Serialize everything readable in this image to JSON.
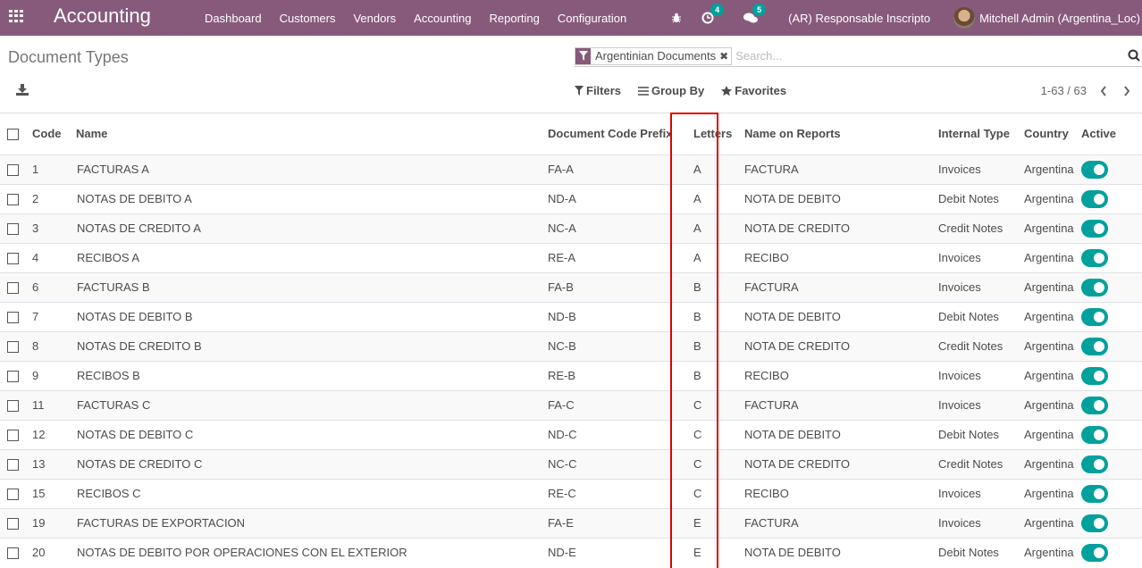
{
  "navbar": {
    "app_title": "Accounting",
    "menu": [
      "Dashboard",
      "Customers",
      "Vendors",
      "Accounting",
      "Reporting",
      "Configuration"
    ],
    "activity_count": "4",
    "message_count": "5",
    "company": "(AR) Responsable Inscripto",
    "user": "Mitchell Admin (Argentina_Loc)",
    "color": "#875a7b"
  },
  "control_panel": {
    "title": "Document Types",
    "facet_label": "Argentinian Documents",
    "search_placeholder": "Search...",
    "filters_label": "Filters",
    "group_by_label": "Group By",
    "favorites_label": "Favorites",
    "pager": "1-63 / 63"
  },
  "table": {
    "columns": [
      "Code",
      "Name",
      "Document Code Prefix",
      "Letters",
      "Name on Reports",
      "Internal Type",
      "Country",
      "Active"
    ],
    "highlighted_column": "Letters",
    "toggle_color": "#00a09d",
    "rows": [
      {
        "code": "1",
        "name": "FACTURAS A",
        "prefix": "FA-A",
        "letter": "A",
        "report_name": "FACTURA",
        "internal_type": "Invoices",
        "country": "Argentina",
        "active": true
      },
      {
        "code": "2",
        "name": "NOTAS DE DEBITO A",
        "prefix": "ND-A",
        "letter": "A",
        "report_name": "NOTA DE DEBITO",
        "internal_type": "Debit Notes",
        "country": "Argentina",
        "active": true
      },
      {
        "code": "3",
        "name": "NOTAS DE CREDITO A",
        "prefix": "NC-A",
        "letter": "A",
        "report_name": "NOTA DE CREDITO",
        "internal_type": "Credit Notes",
        "country": "Argentina",
        "active": true
      },
      {
        "code": "4",
        "name": "RECIBOS A",
        "prefix": "RE-A",
        "letter": "A",
        "report_name": "RECIBO",
        "internal_type": "Invoices",
        "country": "Argentina",
        "active": true
      },
      {
        "code": "6",
        "name": "FACTURAS B",
        "prefix": "FA-B",
        "letter": "B",
        "report_name": "FACTURA",
        "internal_type": "Invoices",
        "country": "Argentina",
        "active": true
      },
      {
        "code": "7",
        "name": "NOTAS DE DEBITO B",
        "prefix": "ND-B",
        "letter": "B",
        "report_name": "NOTA DE DEBITO",
        "internal_type": "Debit Notes",
        "country": "Argentina",
        "active": true
      },
      {
        "code": "8",
        "name": "NOTAS DE CREDITO B",
        "prefix": "NC-B",
        "letter": "B",
        "report_name": "NOTA DE CREDITO",
        "internal_type": "Credit Notes",
        "country": "Argentina",
        "active": true
      },
      {
        "code": "9",
        "name": "RECIBOS B",
        "prefix": "RE-B",
        "letter": "B",
        "report_name": "RECIBO",
        "internal_type": "Invoices",
        "country": "Argentina",
        "active": true
      },
      {
        "code": "11",
        "name": "FACTURAS C",
        "prefix": "FA-C",
        "letter": "C",
        "report_name": "FACTURA",
        "internal_type": "Invoices",
        "country": "Argentina",
        "active": true
      },
      {
        "code": "12",
        "name": "NOTAS DE DEBITO C",
        "prefix": "ND-C",
        "letter": "C",
        "report_name": "NOTA DE DEBITO",
        "internal_type": "Debit Notes",
        "country": "Argentina",
        "active": true
      },
      {
        "code": "13",
        "name": "NOTAS DE CREDITO C",
        "prefix": "NC-C",
        "letter": "C",
        "report_name": "NOTA DE CREDITO",
        "internal_type": "Credit Notes",
        "country": "Argentina",
        "active": true
      },
      {
        "code": "15",
        "name": "RECIBOS C",
        "prefix": "RE-C",
        "letter": "C",
        "report_name": "RECIBO",
        "internal_type": "Invoices",
        "country": "Argentina",
        "active": true
      },
      {
        "code": "19",
        "name": "FACTURAS DE EXPORTACION",
        "prefix": "FA-E",
        "letter": "E",
        "report_name": "FACTURA",
        "internal_type": "Invoices",
        "country": "Argentina",
        "active": true
      },
      {
        "code": "20",
        "name": "NOTAS DE DEBITO POR OPERACIONES CON EL EXTERIOR",
        "prefix": "ND-E",
        "letter": "E",
        "report_name": "NOTA DE DEBITO",
        "internal_type": "Debit Notes",
        "country": "Argentina",
        "active": true
      }
    ]
  }
}
